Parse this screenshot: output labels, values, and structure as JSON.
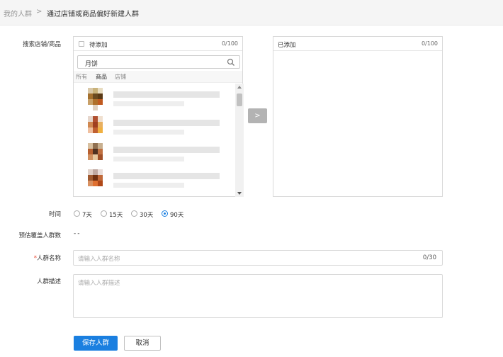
{
  "breadcrumb": {
    "home": "我的人群",
    "separator": ">",
    "current": "通过店铺或商品偏好新建人群"
  },
  "search_label": "搜索店铺/商品",
  "pending": {
    "title": "待添加",
    "count": "0/100",
    "search_value": "月饼",
    "filters": [
      "所有",
      "商品",
      "店铺"
    ]
  },
  "added": {
    "title": "已添加",
    "count": "0/100"
  },
  "move_button": ">",
  "time": {
    "label": "时间",
    "options": [
      "7天",
      "15天",
      "30天",
      "90天"
    ],
    "selected": "90天"
  },
  "coverage": {
    "label": "预估覆盖人群数",
    "value": "--"
  },
  "name": {
    "required_mark": "*",
    "label": "人群名称",
    "placeholder": "请输入人群名称",
    "count": "0/30"
  },
  "desc": {
    "label": "人群描述",
    "placeholder": "请输入人群描述"
  },
  "actions": {
    "save": "保存人群",
    "cancel": "取消"
  }
}
